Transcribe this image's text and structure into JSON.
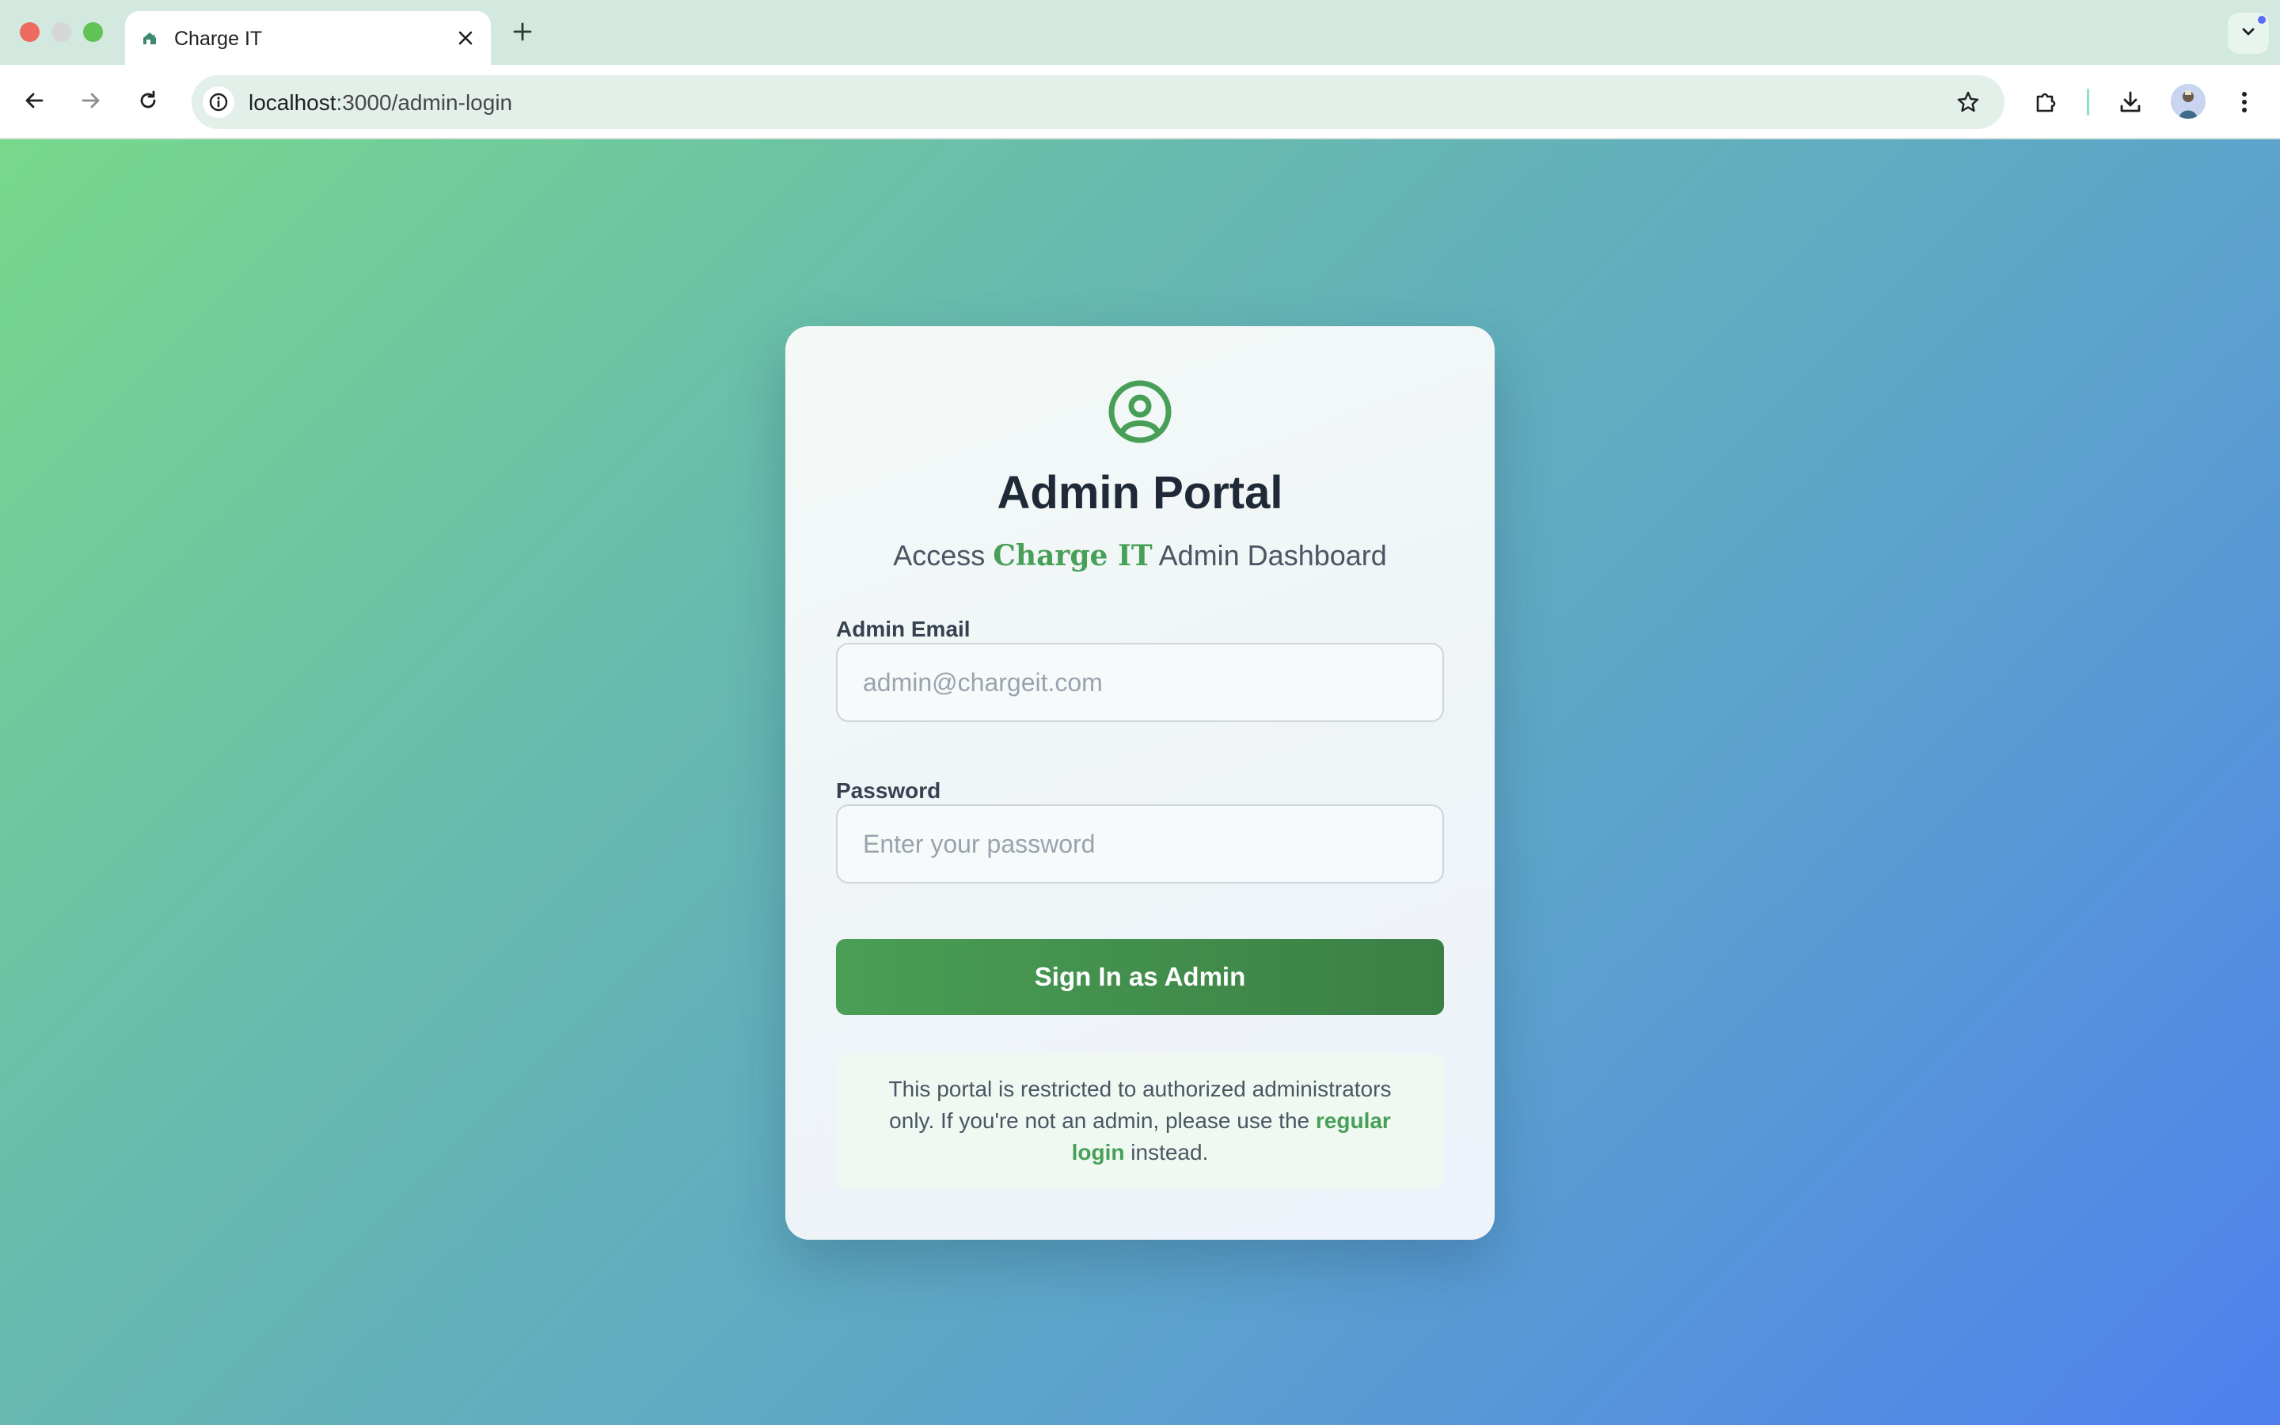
{
  "browser": {
    "tab": {
      "title": "Charge IT",
      "favicon": "charge-it-favicon",
      "close_icon": "close-icon"
    },
    "new_tab_icon": "plus-icon",
    "tab_search_icon": "chevron-down-icon",
    "address_bar": {
      "host": "localhost",
      "path": ":3000/admin-login",
      "info_icon": "info-icon",
      "bookmark_icon": "star-icon"
    },
    "nav": {
      "back_icon": "arrow-left-icon",
      "forward_icon": "arrow-right-icon",
      "reload_icon": "reload-icon"
    },
    "toolbar_icons": [
      "extensions-icon",
      "download-icon",
      "avatar",
      "more-vert-icon"
    ]
  },
  "page": {
    "background_colors": [
      "#77d88c",
      "#66b9b0",
      "#5ca3cc",
      "#4f80ee"
    ],
    "accent_color": "#48a058",
    "card": {
      "icon": "user-circle-icon",
      "title": "Admin Portal",
      "subtitle_prefix": "Access",
      "subtitle_brand": "Charge IT",
      "subtitle_suffix": "Admin Dashboard",
      "email": {
        "label": "Admin Email",
        "placeholder": "admin@chargeit.com",
        "value": ""
      },
      "password": {
        "label": "Password",
        "placeholder": "Enter your password",
        "value": ""
      },
      "submit_label": "Sign In as Admin",
      "notice": {
        "text_before": "This portal is restricted to authorized administrators only. If you're not an admin, please use the",
        "link_text": "regular login",
        "text_after": "instead."
      }
    }
  }
}
